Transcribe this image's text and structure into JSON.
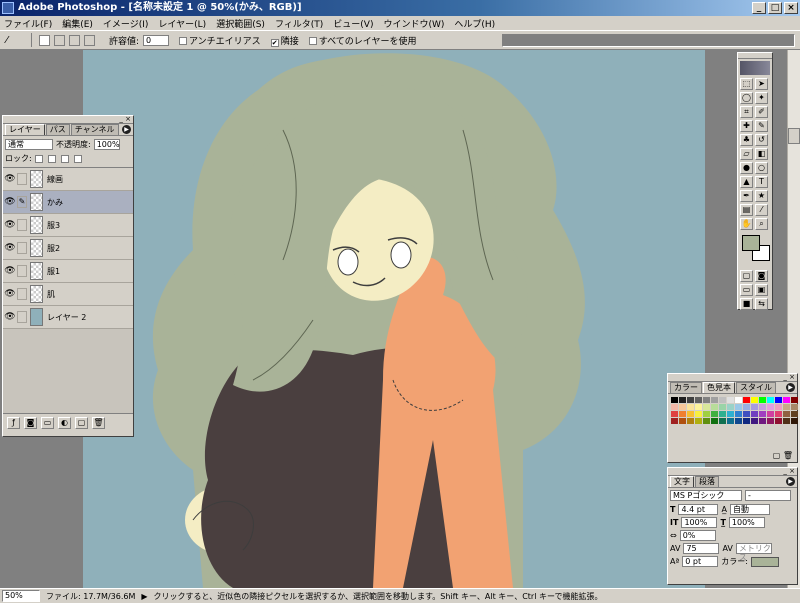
{
  "window": {
    "title": "Adobe Photoshop - [名称未設定 1 @ 50%(かみ、RGB)]",
    "minimize": "_",
    "maximize": "□",
    "close": "×"
  },
  "menu": [
    "ファイル(F)",
    "編集(E)",
    "イメージ(I)",
    "レイヤー(L)",
    "選択範囲(S)",
    "フィルタ(T)",
    "ビュー(V)",
    "ウインドウ(W)",
    "ヘルプ(H)"
  ],
  "options": {
    "tolerance_label": "許容値:",
    "tolerance_value": "0",
    "antialias": "アンチエイリアス",
    "contiguous": "隣接",
    "all_layers": "すべてのレイヤーを使用",
    "contiguous_mark": "✔"
  },
  "layers_panel": {
    "tabs": [
      "レイヤー",
      "パス",
      "チャンネル"
    ],
    "blend_mode": "通常",
    "opacity_label": "不透明度:",
    "opacity_value": "100%",
    "lock_label": "ロック:",
    "layers": [
      {
        "name": "線画",
        "selected": false,
        "icon": "eye-icon"
      },
      {
        "name": "かみ",
        "selected": true,
        "icon": "eye-icon"
      },
      {
        "name": "服3",
        "selected": false,
        "icon": "eye-icon"
      },
      {
        "name": "服2",
        "selected": false,
        "icon": "eye-icon"
      },
      {
        "name": "服1",
        "selected": false,
        "icon": "eye-icon"
      },
      {
        "name": "肌",
        "selected": false,
        "icon": "eye-icon"
      },
      {
        "name": "レイヤー 2",
        "selected": false,
        "icon": "eye-icon"
      }
    ]
  },
  "swatches_panel": {
    "tabs": [
      "カラー",
      "色見本",
      "スタイル"
    ],
    "colors": [
      "#000000",
      "#202020",
      "#404040",
      "#606060",
      "#808080",
      "#a0a0a0",
      "#c0c0c0",
      "#e0e0e0",
      "#ffffff",
      "#ff0000",
      "#ffff00",
      "#00ff00",
      "#00ffff",
      "#0000ff",
      "#ff00ff",
      "#800000",
      "#f2b8a8",
      "#f7c79a",
      "#fbe49a",
      "#fdf49c",
      "#d8e89a",
      "#b8dd9a",
      "#9ad4a8",
      "#9ad2c8",
      "#9ac8e8",
      "#9ab0e0",
      "#a89ce0",
      "#c69ce0",
      "#e49ce0",
      "#f09cc0",
      "#c8a888",
      "#a88868",
      "#e04040",
      "#f08030",
      "#f8c030",
      "#f8f040",
      "#a0d040",
      "#40b040",
      "#30b090",
      "#30b0d0",
      "#3080d0",
      "#4050c0",
      "#7040c0",
      "#a040c0",
      "#d040a0",
      "#e04070",
      "#906040",
      "#604020",
      "#a02020",
      "#b05010",
      "#b08010",
      "#b0b010",
      "#609010",
      "#107010",
      "#107050",
      "#107090",
      "#104890",
      "#102880",
      "#401880",
      "#701880",
      "#901860",
      "#901030",
      "#503018",
      "#301808"
    ]
  },
  "char_panel": {
    "tabs": [
      "文字",
      "段落"
    ],
    "font": "MS Pゴシック",
    "style": "-",
    "size": "4.4 pt",
    "leading": "自動",
    "vscale": "100%",
    "hscale": "100%",
    "tsume": "0%",
    "tracking": "75",
    "kerning": "メトリクス",
    "baseline": "0 pt",
    "color_label": "カラー:",
    "color": "#a9b398"
  },
  "status": {
    "zoom": "50%",
    "file": "ファイル: 17.7M/36.6M",
    "hint": "クリックすると、近似色の隣接ピクセルを選択するか、選択範囲を移動します。Shift キー、Alt キー、Ctrl キーで機能拡張。"
  },
  "colors": {
    "canvas_bg": "#8fb0ba",
    "hair": "#a9b398",
    "skin": "#f4edc4",
    "sweater": "#4a3f3f",
    "scarf": "#f2a272",
    "line": "#3d3d3d"
  }
}
